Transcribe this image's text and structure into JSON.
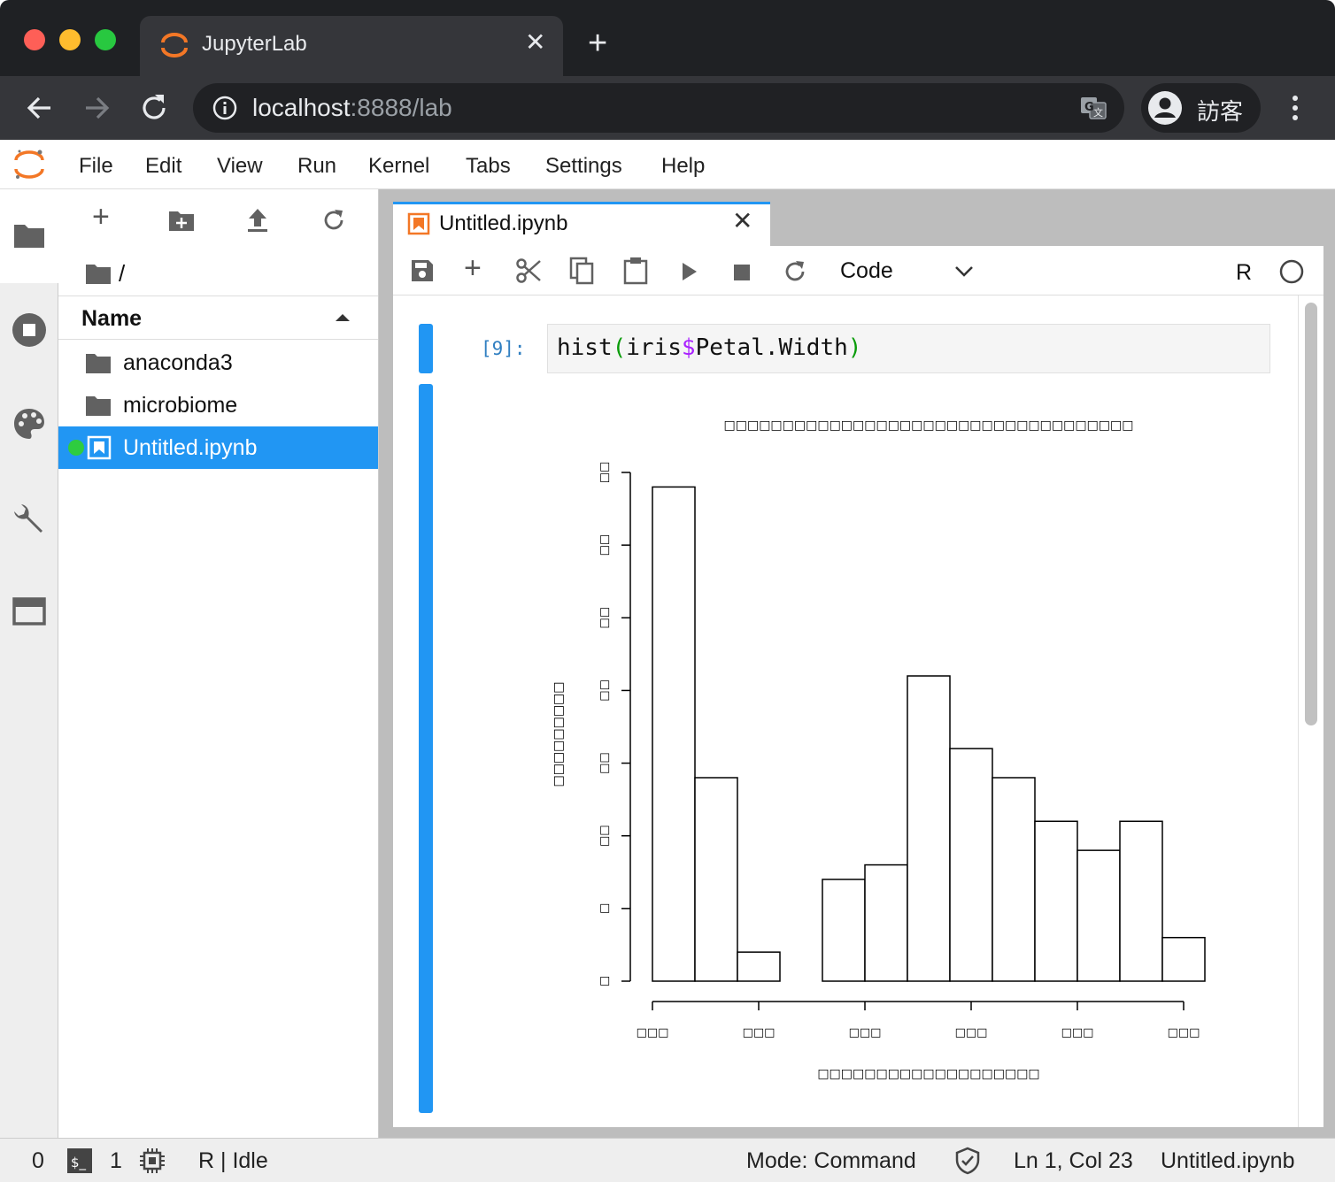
{
  "window": {
    "tab_title": "JupyterLab",
    "url_host": "localhost",
    "url_path": ":8888/lab",
    "profile_label": "訪客"
  },
  "menu": [
    "File",
    "Edit",
    "View",
    "Run",
    "Kernel",
    "Tabs",
    "Settings",
    "Help"
  ],
  "filebrowser": {
    "path": "/",
    "column_header": "Name",
    "items": [
      {
        "name": "anaconda3",
        "type": "folder",
        "selected": false
      },
      {
        "name": "microbiome",
        "type": "folder",
        "selected": false
      },
      {
        "name": "Untitled.ipynb",
        "type": "notebook",
        "selected": true,
        "running": true
      }
    ]
  },
  "notebook": {
    "tab_title": "Untitled.ipynb",
    "cell_type": "Code",
    "kernel_name": "R",
    "cell": {
      "prompt": "[9]:",
      "code_prefix": "hist",
      "code_open": "(",
      "code_obj": "iris",
      "code_dollar": "$",
      "code_field": "Petal.Width",
      "code_close": ")"
    }
  },
  "chart_data": {
    "type": "bar",
    "subtype": "histogram",
    "title": "□□□□□□□□□□□□□□□□□□□□□□□□□□□□□□□□□□□",
    "xlabel": "□□□□□□□□□□□□□□□□□□□",
    "ylabel": "□□□□□□□□□",
    "bin_edges": [
      0.0,
      0.2,
      0.4,
      0.6,
      0.8,
      1.0,
      1.2,
      1.4,
      1.6,
      1.8,
      2.0,
      2.2,
      2.4,
      2.6
    ],
    "values": [
      34,
      14,
      2,
      0,
      7,
      8,
      21,
      16,
      14,
      11,
      9,
      11,
      3
    ],
    "ylim": [
      0,
      35
    ],
    "xlim": [
      0.0,
      2.5
    ],
    "x_ticks": [
      0.0,
      0.5,
      1.0,
      1.5,
      2.0,
      2.5
    ],
    "y_ticks": [
      0,
      5,
      10,
      15,
      20,
      25,
      30,
      35
    ],
    "x_tick_labels": [
      "□□□",
      "□□□",
      "□□□",
      "□□□",
      "□□□",
      "□□□"
    ],
    "y_tick_labels": [
      "□",
      "□",
      "□□",
      "□□",
      "□□",
      "□□",
      "□□",
      "□□"
    ],
    "grid": false,
    "legend": "none"
  },
  "status": {
    "terminals": "0",
    "kernels": "1",
    "kernel_status": "R | Idle",
    "mode": "Mode: Command",
    "cursor": "Ln 1, Col 23",
    "file": "Untitled.ipynb"
  },
  "colors": {
    "accent": "#2196f3",
    "jupyter_orange": "#f37726",
    "running_green": "#2ecc40"
  }
}
